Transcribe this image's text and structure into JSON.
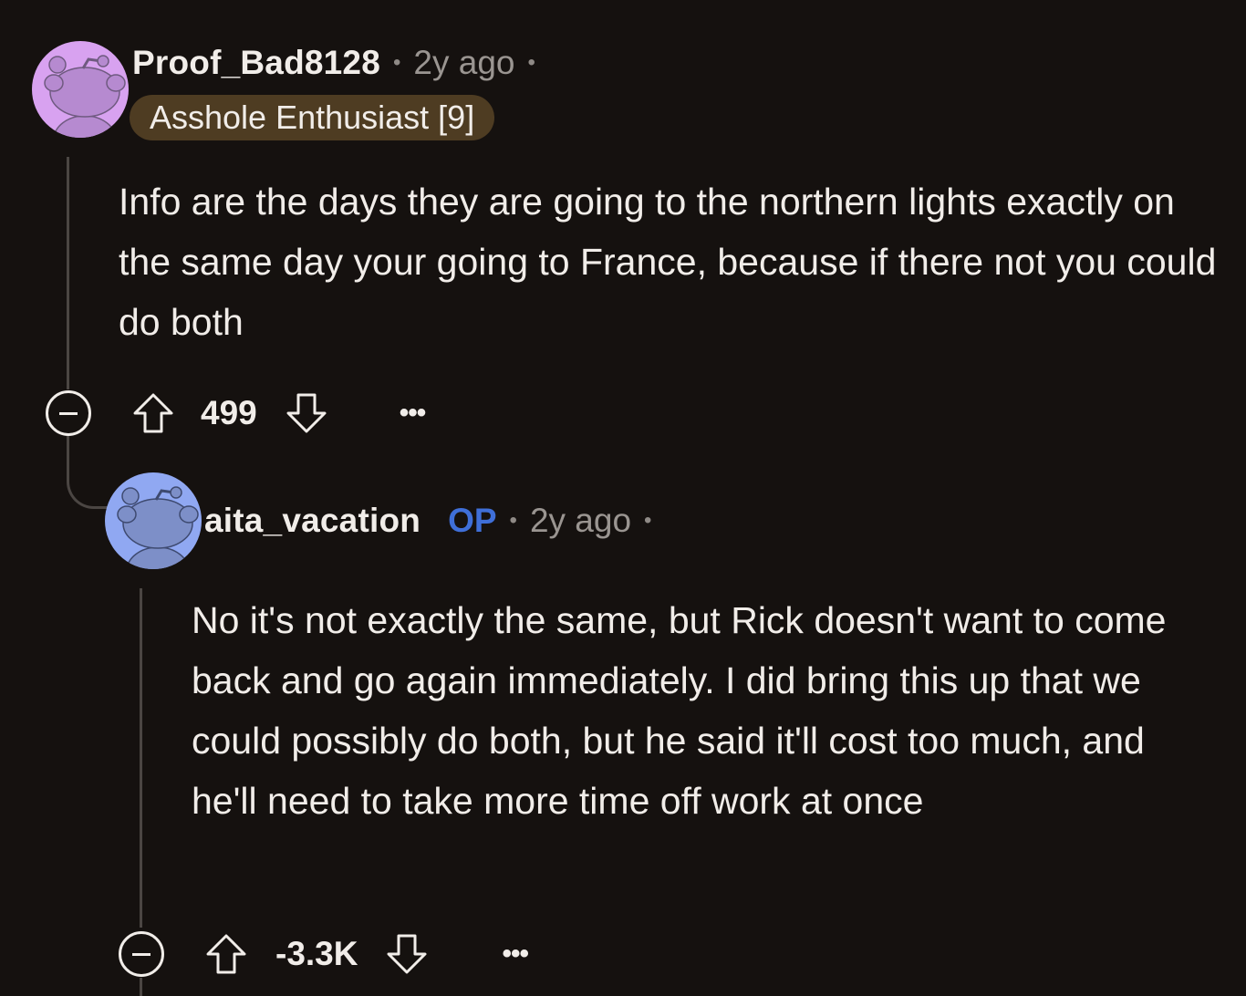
{
  "comments": [
    {
      "username": "Proof_Bad8128",
      "op_label": "",
      "time": "2y ago",
      "flair": "Asshole Enthusiast [9]",
      "body": "Info are the days they are going to the northern lights exactly on the same day your going to France, because if there not you could do both",
      "score": "499",
      "avatar_color": "#d8a2f0"
    },
    {
      "username": "aita_vacation",
      "op_label": "OP",
      "time": "2y ago",
      "flair": "",
      "body": "No it's not exactly the same, but Rick doesn't want to come back and go again immediately. I did bring this up that we could possibly do both, but he said it'll cost too much, and he'll need to take more time off work at once",
      "score": "-3.3K",
      "avatar_color": "#90a8f2"
    }
  ],
  "icons": {
    "collapse": "minus-circle-icon",
    "upvote": "upvote-arrow-icon",
    "downvote": "downvote-arrow-icon",
    "more": "more-options-icon",
    "more_glyph": "•••"
  },
  "colors": {
    "background": "#15110f",
    "op_blue": "#3f6fd8",
    "flair_bg": "#4e3c22",
    "thread_line": "#4b4643"
  }
}
